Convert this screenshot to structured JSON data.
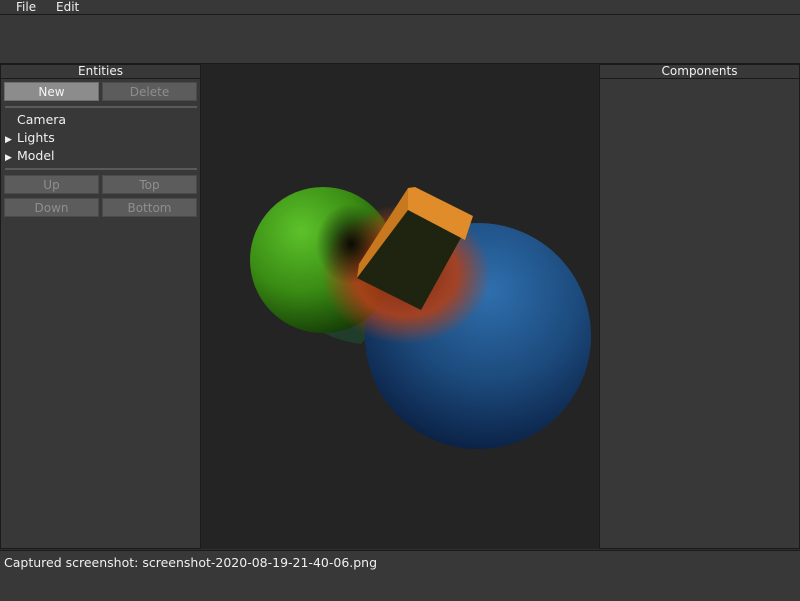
{
  "menubar": {
    "items": [
      "File",
      "Edit"
    ]
  },
  "entities_panel": {
    "title": "Entities",
    "new_label": "New",
    "delete_label": "Delete",
    "tree": [
      {
        "label": "Camera",
        "expandable": false
      },
      {
        "label": "Lights",
        "expandable": true
      },
      {
        "label": "Model",
        "expandable": true
      }
    ],
    "up_label": "Up",
    "top_label": "Top",
    "down_label": "Down",
    "bottom_label": "Bottom"
  },
  "components_panel": {
    "title": "Components"
  },
  "status": {
    "message": "Captured screenshot: screenshot-2020-08-19-21-40-06.png"
  },
  "colors": {
    "green_blob": "#3f9a16",
    "blue_blob": "#1e4f82",
    "orange_glow": "#b0401a",
    "cube_top": "#e08c2a",
    "cube_face": "#1e2410"
  }
}
